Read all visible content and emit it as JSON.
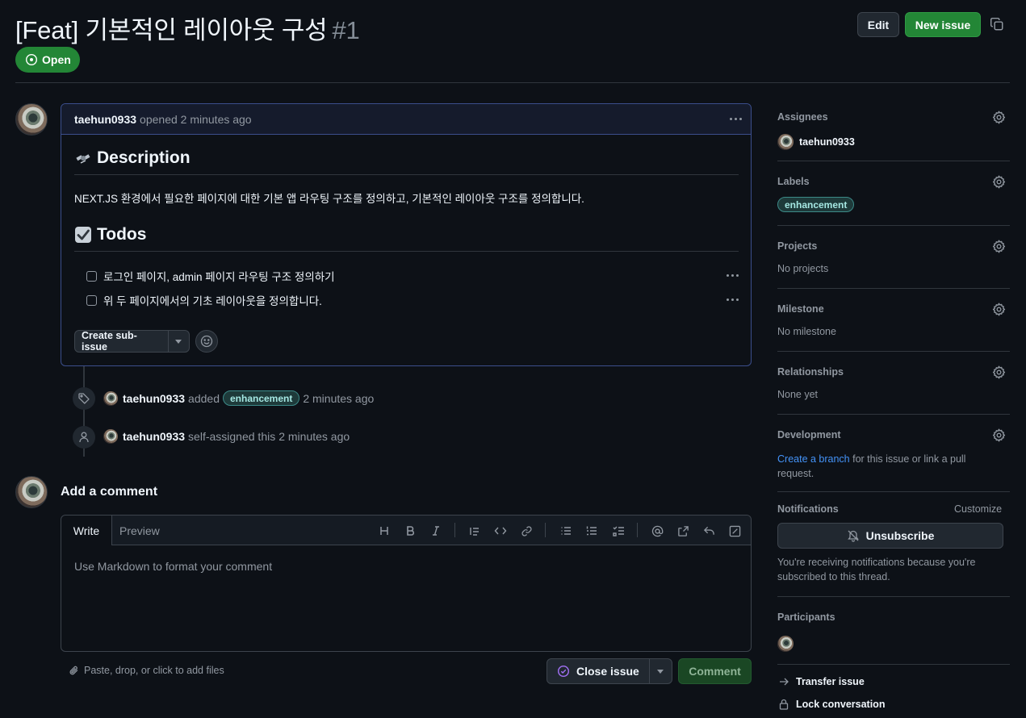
{
  "issue": {
    "title": "[Feat] 기본적인 레이아웃 구성",
    "number": "#1",
    "state": "Open"
  },
  "header": {
    "edit_label": "Edit",
    "new_issue_label": "New issue"
  },
  "body": {
    "author": "taehun0933",
    "meta": "opened 2 minutes ago",
    "description_heading": "Description",
    "description_text": "NEXT.JS 환경에서 필요한 페이지에 대한 기본 앱 라우팅 구조를 정의하고, 기본적인 레이아웃 구조를 정의합니다.",
    "todos_heading": "Todos",
    "todos": [
      {
        "label": "로그인 페이지, admin 페이지 라우팅 구조 정의하기",
        "checked": false
      },
      {
        "label": "위 두 페이지에서의 기초 레이아웃을 정의합니다.",
        "checked": false
      }
    ],
    "create_subissue_label": "Create sub-issue"
  },
  "timeline": [
    {
      "actor": "taehun0933",
      "action": "added",
      "label": "enhancement",
      "time": "2 minutes ago",
      "icon": "tag-icon"
    },
    {
      "actor": "taehun0933",
      "action": "self-assigned this",
      "time": "2 minutes ago",
      "icon": "person-icon"
    }
  ],
  "comment": {
    "heading": "Add a comment",
    "tab_write": "Write",
    "tab_preview": "Preview",
    "placeholder": "Use Markdown to format your comment",
    "attach_text": "Paste, drop, or click to add files",
    "close_issue_label": "Close issue",
    "comment_label": "Comment",
    "accent_color": "#238636"
  },
  "sidebar": {
    "assignees": {
      "title": "Assignees",
      "user": "taehun0933"
    },
    "labels": {
      "title": "Labels",
      "label": "enhancement"
    },
    "projects": {
      "title": "Projects",
      "value": "No projects"
    },
    "milestone": {
      "title": "Milestone",
      "value": "No milestone"
    },
    "relationships": {
      "title": "Relationships",
      "value": "None yet"
    },
    "development": {
      "title": "Development",
      "link_text": "Create a branch",
      "rest_text": " for this issue or link a pull request."
    },
    "notifications": {
      "title": "Notifications",
      "customize": "Customize",
      "unsubscribe_label": "Unsubscribe",
      "reason": "You're receiving notifications because you're subscribed to this thread."
    },
    "participants": {
      "title": "Participants"
    },
    "transfer_label": "Transfer issue",
    "lock_label": "Lock conversation"
  }
}
